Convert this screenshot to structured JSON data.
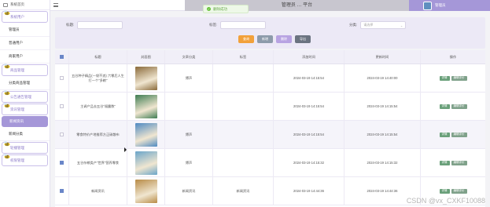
{
  "topbar": {
    "title": "管理员 … 平台",
    "user_label": "管理员",
    "toast": "删除成功"
  },
  "sidebar": {
    "home": "系统首页",
    "items": [
      {
        "label": "系统用户",
        "kind": "group"
      },
      {
        "label": "管理员",
        "kind": "sub"
      },
      {
        "label": "普通用户",
        "kind": "sub"
      },
      {
        "label": "商家用户",
        "kind": "sub"
      },
      {
        "label": "商品管理",
        "kind": "group"
      },
      {
        "label": "分类商品管理",
        "kind": "sub"
      },
      {
        "label": "公告通告管理",
        "kind": "group"
      },
      {
        "label": "资讯管理",
        "kind": "group"
      },
      {
        "label": "新闻资讯",
        "kind": "active"
      },
      {
        "label": "新闻分类",
        "kind": "sub"
      },
      {
        "label": "轮播管理",
        "kind": "group"
      },
      {
        "label": "权限管理",
        "kind": "group"
      }
    ]
  },
  "search": {
    "field1_label": "标题:",
    "field2_label": "标签:",
    "field3_label": "分类:",
    "select_placeholder": "请选择",
    "buttons": [
      "查询",
      "新增",
      "删除",
      "导出"
    ]
  },
  "table": {
    "headers": [
      "",
      "标题",
      "封面图",
      "文章分类",
      "标签",
      "添加时间",
      "更新时间",
      "操作"
    ],
    "rows": [
      {
        "title": "五谷种子精品(一袋不浪) 六零后人生打一个\"多粮\"",
        "type": "博声",
        "intro": "",
        "ctime": "2024-03-19 14:15:54",
        "mtime": "2024-03-19 14:40:00",
        "checked": false,
        "img": "#8a6a3a"
      },
      {
        "title": "主调产品去五谷\"福露数\"",
        "type": "",
        "intro": "",
        "ctime": "2024-03-19 14:15:54",
        "mtime": "2024-03-19 14:15:54",
        "checked": false,
        "img": "#3f7d53"
      },
      {
        "title": "零食特价产地推荐方正碳散布",
        "type": "博声",
        "intro": "",
        "ctime": "2024-03-19 14:15:54",
        "mtime": "2024-03-19 14:15:54",
        "checked": false,
        "img": "#4f8ac2"
      },
      {
        "title": "五谷杂粮类产\"世界\"营养零食",
        "type": "博声",
        "intro": "",
        "ctime": "2024-03-19 14:15:32",
        "mtime": "2024-03-19 14:15:32",
        "checked": true,
        "img": "#6aa5c9"
      },
      {
        "title": "新闻资讯",
        "type": "新闻资讯",
        "intro": "新闻资讯",
        "ctime": "2024-03-19 14:44:36",
        "mtime": "2024-03-19 14:44:36",
        "checked": true,
        "img": "#b88b46"
      }
    ],
    "op_labels": [
      "详情",
      "编辑评价"
    ]
  },
  "watermark": "CSDN @vx_CXKF10088"
}
